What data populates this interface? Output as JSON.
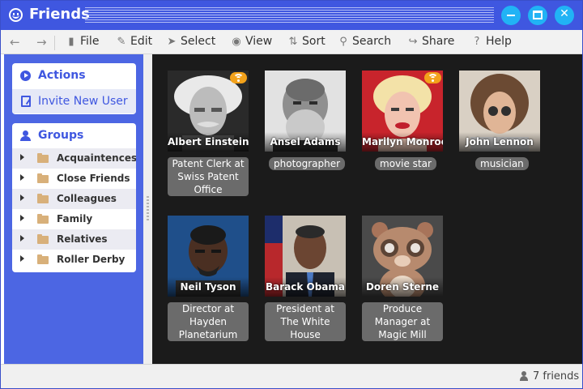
{
  "window": {
    "title": "Friends",
    "colors": {
      "titlebar": "#3f57e0",
      "window_button": "#21b3f5",
      "sidebar": "#4c66e3",
      "content": "#1b1b1b",
      "tag_bg": "#6b6b6b",
      "badge": "#f3a21b"
    }
  },
  "titlebar": {
    "app_icon": "smiley-icon",
    "buttons": {
      "minimize": "minimize-icon",
      "maximize": "maximize-icon",
      "close": "close-icon"
    }
  },
  "toolbar": {
    "back_icon": "arrow-left-icon",
    "forward_icon": "arrow-right-icon",
    "items": [
      {
        "label": "File",
        "icon": "file-icon"
      },
      {
        "label": "Edit",
        "icon": "pencil-icon"
      },
      {
        "label": "Select",
        "icon": "cursor-icon"
      },
      {
        "label": "View",
        "icon": "eye-icon"
      },
      {
        "label": "Sort",
        "icon": "sort-icon"
      },
      {
        "label": "Search",
        "icon": "search-icon"
      },
      {
        "label": "Share",
        "icon": "share-icon"
      },
      {
        "label": "Help",
        "icon": "help-icon"
      }
    ]
  },
  "sidebar": {
    "actions": {
      "heading": "Actions",
      "items": [
        {
          "label": "Invite New User"
        }
      ]
    },
    "groups": {
      "heading": "Groups",
      "items": [
        {
          "label": "Acquaintences"
        },
        {
          "label": "Close Friends"
        },
        {
          "label": "Colleagues"
        },
        {
          "label": "Family"
        },
        {
          "label": "Relatives"
        },
        {
          "label": "Roller Derby"
        }
      ]
    }
  },
  "friends": [
    {
      "name": "Albert Einstein",
      "description": "Patent Clerk at Swiss Patent Office",
      "online": true
    },
    {
      "name": "Ansel Adams",
      "description": "photographer",
      "online": false
    },
    {
      "name": "Marilyn Monroe",
      "description": "movie star",
      "online": true
    },
    {
      "name": "John Lennon",
      "description": "musician",
      "online": false
    },
    {
      "name": "Neil Tyson",
      "description": "Director at Hayden Planetarium",
      "online": false
    },
    {
      "name": "Barack Obama",
      "description": "President at The White House",
      "online": false
    },
    {
      "name": "Doren Sterne",
      "description": "Produce Manager at Magic Mill",
      "online": false
    }
  ],
  "status": {
    "count_label": "7 friends"
  }
}
